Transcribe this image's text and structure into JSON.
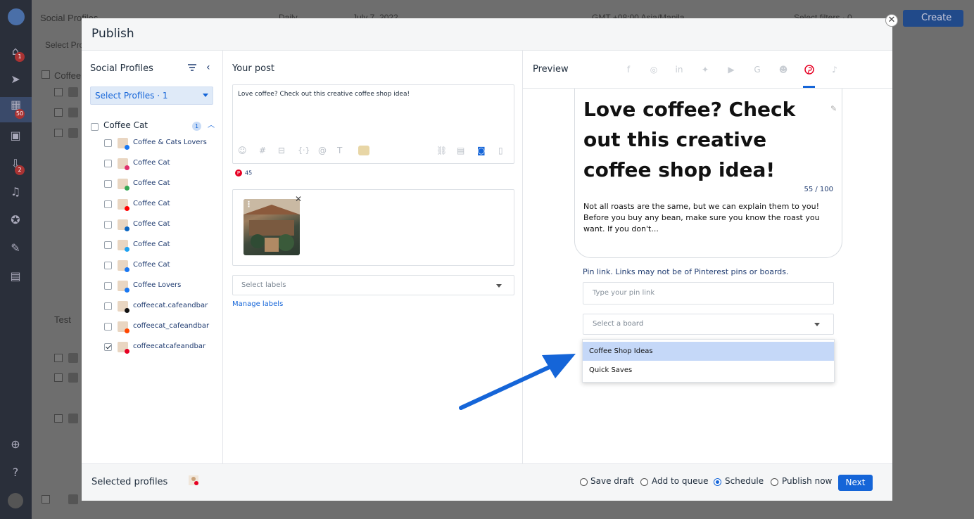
{
  "background": {
    "page_title": "Social Profiles",
    "filter_button": "Select Pro",
    "view_mode": "Daily",
    "date": "July 7, 2022",
    "timezone": "GMT +08:00 Asia/Manila",
    "filters": "Select filters · 0",
    "create_label": "Create",
    "group_coffee": "Coffee",
    "group_test": "Test",
    "rail_badges": [
      "1",
      "50",
      "2"
    ]
  },
  "modal": {
    "title": "Publish"
  },
  "profiles_panel": {
    "title": "Social Profiles",
    "select_label": "Select Profiles · 1",
    "group_name": "Coffee Cat",
    "group_badge": "1",
    "items": [
      {
        "name": "Coffee & Cats Lovers",
        "network": "facebook",
        "checked": false
      },
      {
        "name": "Coffee Cat",
        "network": "instagram",
        "checked": false
      },
      {
        "name": "Coffee Cat",
        "network": "google",
        "checked": false
      },
      {
        "name": "Coffee Cat",
        "network": "youtube",
        "checked": false
      },
      {
        "name": "Coffee Cat",
        "network": "linkedin",
        "checked": false
      },
      {
        "name": "Coffee Cat",
        "network": "twitter",
        "checked": false
      },
      {
        "name": "Coffee Cat",
        "network": "facebook",
        "checked": false
      },
      {
        "name": "Coffee Lovers",
        "network": "facebook",
        "checked": false
      },
      {
        "name": "coffeecat.cafeandbar",
        "network": "tiktok",
        "checked": false
      },
      {
        "name": "coffeecat_cafeandbar",
        "network": "reddit",
        "checked": false
      },
      {
        "name": "coffeecatcafeandbar",
        "network": "pinterest",
        "checked": true
      }
    ]
  },
  "post_panel": {
    "title": "Your post",
    "text": "Love coffee? Check out this creative coffee shop idea!",
    "char_count": "45",
    "labels_placeholder": "Select labels",
    "manage_labels": "Manage labels"
  },
  "preview_panel": {
    "title": "Preview",
    "active_network": "pinterest",
    "pin_title": "Love coffee? Check out this creative coffee shop idea!",
    "pin_title_count": "55 / 100",
    "pin_description": "Not all roasts are the same, but we can explain them to you! Before you buy any bean, make sure you know the roast you want. If you don't...",
    "pin_link_label": "Pin link. Links may not be of Pinterest pins or boards.",
    "pin_link_placeholder": "Type your pin link",
    "board_placeholder": "Select a board",
    "board_options": [
      "Coffee Shop Ideas",
      "Quick Saves"
    ],
    "highlighted_option": "Coffee Shop Ideas"
  },
  "footer": {
    "selected_profiles_label": "Selected profiles",
    "options": [
      {
        "label": "Save draft",
        "selected": false
      },
      {
        "label": "Add to queue",
        "selected": false
      },
      {
        "label": "Schedule",
        "selected": true
      },
      {
        "label": "Publish now",
        "selected": false
      }
    ],
    "next_label": "Next"
  },
  "colors": {
    "accent": "#1565d8",
    "pinterest": "#e60023",
    "highlight": "#c5d8f8"
  }
}
